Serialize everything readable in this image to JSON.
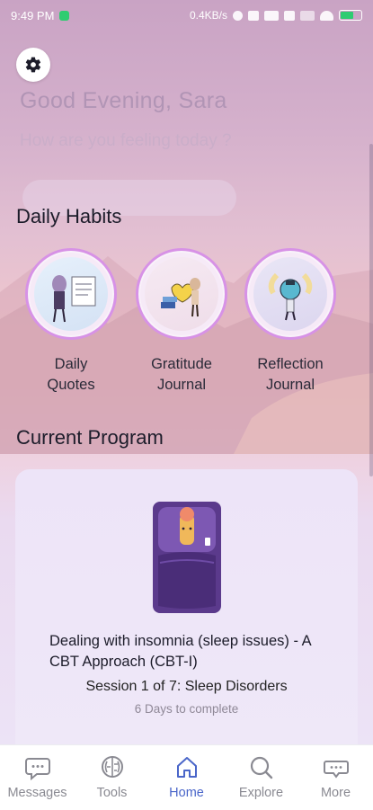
{
  "status_bar": {
    "time": "9:49 PM",
    "speed": "0.4KB/s",
    "battery_level": 0.6
  },
  "header": {
    "greeting": "Good Evening, Sara",
    "prompt": "How are you feeling today ?"
  },
  "habits": {
    "title": "Daily Habits",
    "items": [
      {
        "line1": "Daily",
        "line2": "Quotes",
        "icon": "quote-board-icon"
      },
      {
        "line1": "Gratitude",
        "line2": "Journal",
        "icon": "gratitude-heart-icon"
      },
      {
        "line1": "Reflection",
        "line2": "Journal",
        "icon": "reflection-bulb-icon"
      }
    ]
  },
  "program": {
    "section_title": "Current Program",
    "title": "Dealing with insomnia (sleep issues) - A CBT Approach (CBT-I)",
    "session_prefix": "Session 1 of 7:",
    "session_name": "Sleep Disorders",
    "days": "6 Days to complete"
  },
  "nav": {
    "items": [
      {
        "label": "Messages",
        "icon": "messages-icon"
      },
      {
        "label": "Tools",
        "icon": "brain-icon"
      },
      {
        "label": "Home",
        "icon": "home-icon"
      },
      {
        "label": "Explore",
        "icon": "search-icon"
      },
      {
        "label": "More",
        "icon": "more-icon"
      }
    ],
    "active": "Home"
  },
  "colors": {
    "accent": "#4a66c9",
    "ring": "#d792e6"
  }
}
